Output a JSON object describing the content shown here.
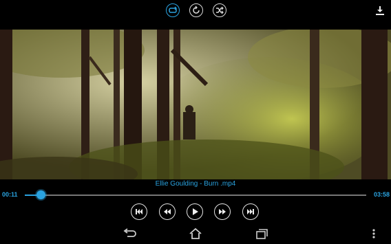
{
  "toolbar": {
    "repeat_icon": "repeat-icon",
    "rotate_icon": "rotate-icon",
    "shuffle_icon": "shuffle-icon",
    "download_icon": "download-icon",
    "accent": "#2aa3e0"
  },
  "player": {
    "title": "Ellie Goulding - Burn .mp4",
    "elapsed": "00:11",
    "duration": "03:58",
    "progress": 0.047
  },
  "controls": {
    "previous_icon": "skip-previous-icon",
    "rewind_icon": "rewind-icon",
    "play_icon": "play-icon",
    "forward_icon": "fast-forward-icon",
    "next_icon": "skip-next-icon"
  },
  "navbar": {
    "back_icon": "back-icon",
    "home_icon": "home-icon",
    "recents_icon": "recent-apps-icon",
    "menu_icon": "overflow-menu-icon"
  }
}
